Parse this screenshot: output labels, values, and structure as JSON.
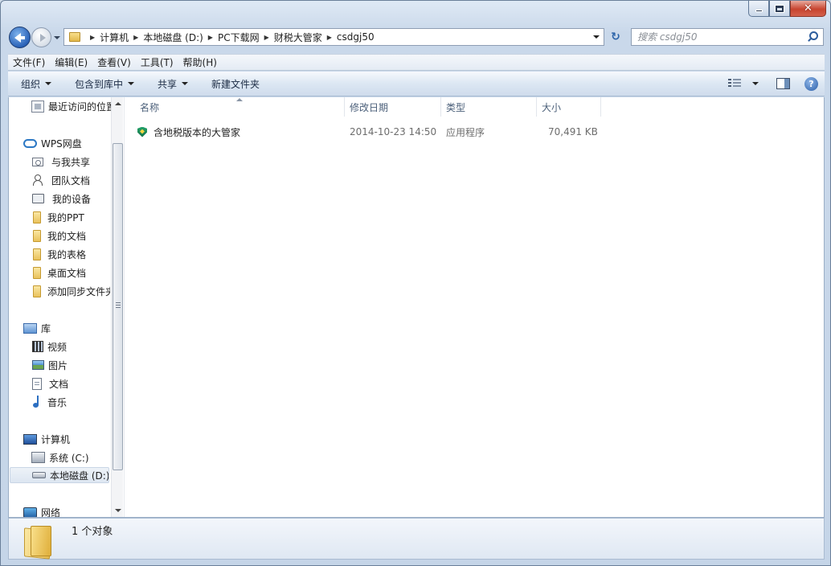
{
  "window": {
    "close_glyph": "✕"
  },
  "address": {
    "crumbs": [
      "计算机",
      "本地磁盘 (D:)",
      "PC下载网",
      "财税大管家",
      "csdgj50"
    ]
  },
  "search": {
    "placeholder": "搜索 csdgj50"
  },
  "menubar": {
    "items": [
      "文件(F)",
      "编辑(E)",
      "查看(V)",
      "工具(T)",
      "帮助(H)"
    ]
  },
  "toolbar": {
    "organize": "组织",
    "include_library": "包含到库中",
    "share": "共享",
    "new_folder": "新建文件夹",
    "help": "?"
  },
  "sidebar": {
    "recent": "最近访问的位置",
    "wps": "WPS网盘",
    "shared_with_me": "与我共享",
    "team_docs": "团队文档",
    "my_devices": "我的设备",
    "my_ppt": "我的PPT",
    "my_docs": "我的文档",
    "my_sheets": "我的表格",
    "desktop_docs": "桌面文档",
    "add_sync": "添加同步文件夹",
    "library": "库",
    "videos": "视频",
    "pictures": "图片",
    "documents": "文档",
    "music": "音乐",
    "computer": "计算机",
    "drive_c": "系统 (C:)",
    "drive_d": "本地磁盘 (D:)",
    "network": "网络"
  },
  "columns": {
    "name": "名称",
    "modified": "修改日期",
    "type": "类型",
    "size": "大小"
  },
  "files": [
    {
      "name": "含地税版本的大管家",
      "modified": "2014-10-23 14:50",
      "type": "应用程序",
      "size": "70,491 KB"
    }
  ],
  "status": {
    "count_text": "1 个对象"
  }
}
